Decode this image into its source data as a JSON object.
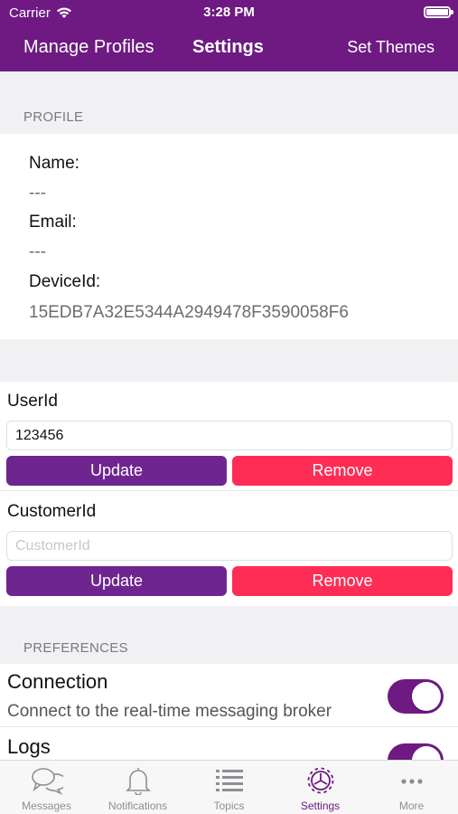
{
  "status_bar": {
    "carrier": "Carrier",
    "time": "3:28 PM"
  },
  "nav": {
    "left": "Manage Profiles",
    "title": "Settings",
    "right": "Set Themes"
  },
  "profile": {
    "header": "PROFILE",
    "name_label": "Name:",
    "name_value": "---",
    "email_label": "Email:",
    "email_value": "---",
    "device_label": "DeviceId:",
    "device_value": "15EDB7A32E5344A2949478F3590058F6"
  },
  "user_id": {
    "label": "UserId",
    "value": "123456",
    "update_label": "Update",
    "remove_label": "Remove"
  },
  "customer_id": {
    "label": "CustomerId",
    "value": "",
    "placeholder": "CustomerId",
    "update_label": "Update",
    "remove_label": "Remove"
  },
  "preferences": {
    "header": "PREFERENCES",
    "connection_title": "Connection",
    "connection_subtitle": "Connect to the real-time messaging broker",
    "connection_on": true,
    "logs_title": "Logs",
    "logs_on": true
  },
  "tabs": [
    {
      "label": "Messages",
      "icon": "chat-bubbles-icon",
      "active": false
    },
    {
      "label": "Notifications",
      "icon": "bell-icon",
      "active": false
    },
    {
      "label": "Topics",
      "icon": "list-icon",
      "active": false
    },
    {
      "label": "Settings",
      "icon": "gear-icon",
      "active": true
    },
    {
      "label": "More",
      "icon": "more-icon",
      "active": false
    }
  ],
  "colors": {
    "brand_purple": "#6e1a82",
    "update_button": "#6e2590",
    "remove_button": "#ff2d55"
  }
}
